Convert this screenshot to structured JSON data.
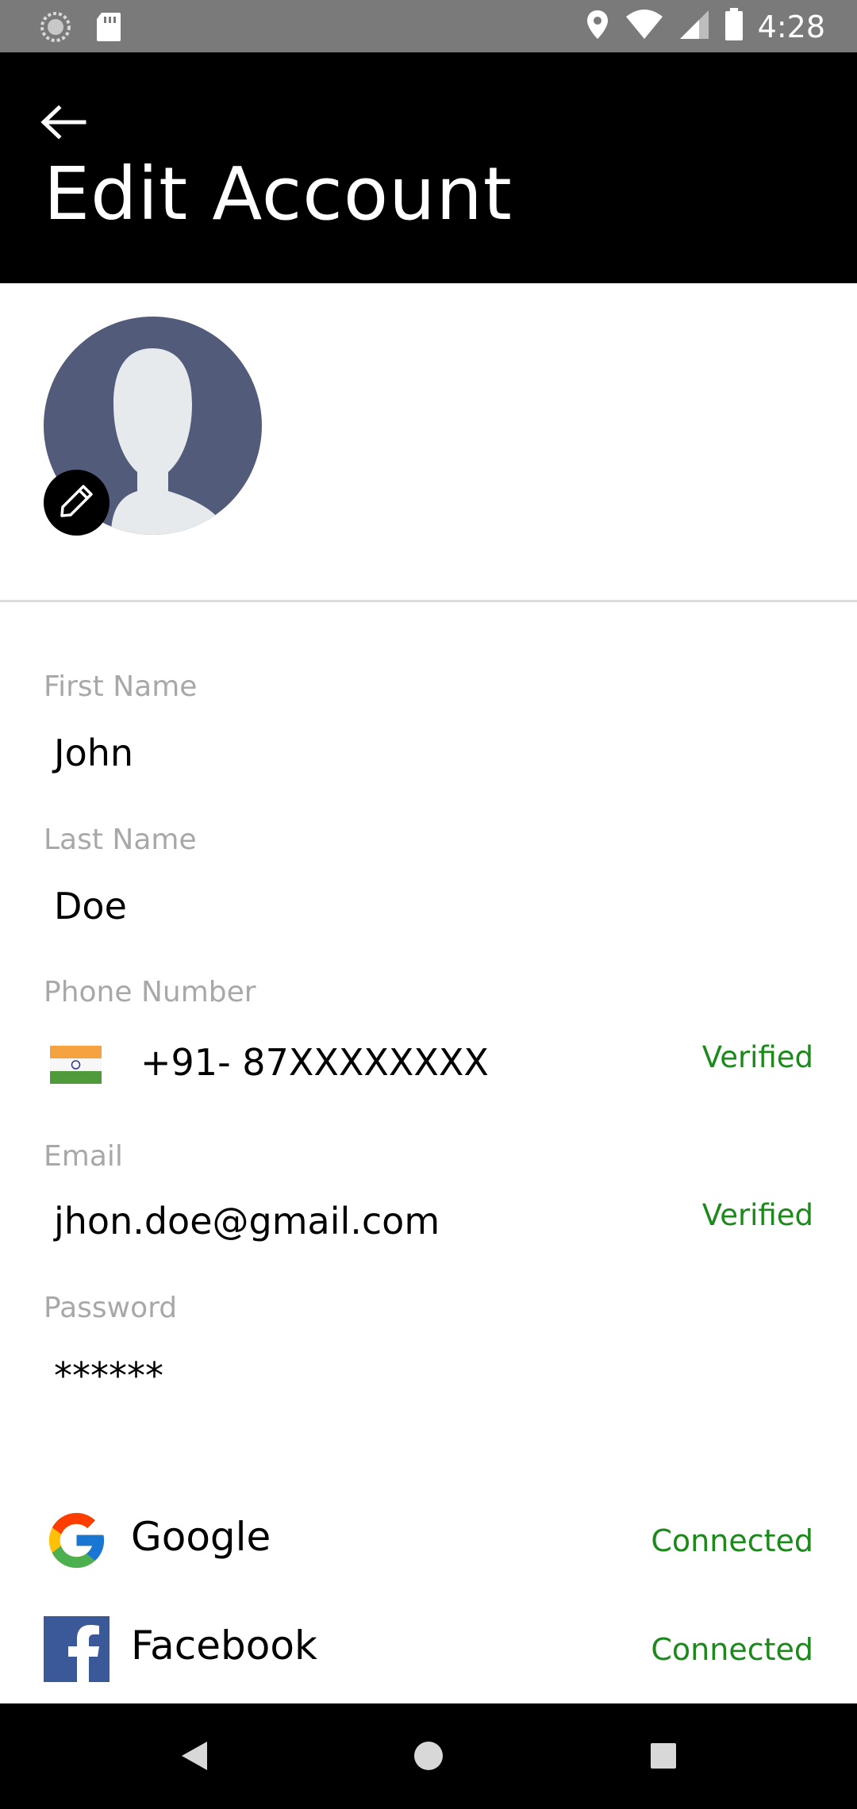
{
  "status_bar": {
    "time": "4:28",
    "icons": [
      "sync-icon",
      "sd-card-icon",
      "location-icon",
      "wifi-icon",
      "signal-icon",
      "battery-icon"
    ]
  },
  "header": {
    "title": "Edit Account",
    "back_icon": "arrow-left-icon"
  },
  "profile": {
    "avatar_icon": "default-user-avatar",
    "edit_icon": "pencil-icon"
  },
  "fields": {
    "first_name": {
      "label": "First Name",
      "value": "John"
    },
    "last_name": {
      "label": "Last Name",
      "value": "Doe"
    },
    "phone": {
      "label": "Phone Number",
      "country_flag": "india-flag-icon",
      "value": "+91- 87XXXXXXXX",
      "status": "Verified"
    },
    "email": {
      "label": "Email",
      "value": "jhon.doe@gmail.com",
      "status": "Verified"
    },
    "password": {
      "label": "Password",
      "value": "******"
    }
  },
  "social": [
    {
      "name": "Google",
      "icon": "google-icon",
      "status": "Connected"
    },
    {
      "name": "Facebook",
      "icon": "facebook-icon",
      "status": "Connected"
    }
  ],
  "colors": {
    "header_bg": "#000000",
    "status_bar_bg": "#7a7a7a",
    "verified_green": "#1b8a1b",
    "label_gray": "#a8a8a8",
    "avatar_bg": "#525c7a",
    "facebook_blue": "#3b5998"
  },
  "nav_bar": {
    "icons": [
      "back-nav-icon",
      "home-nav-icon",
      "recents-nav-icon"
    ]
  }
}
